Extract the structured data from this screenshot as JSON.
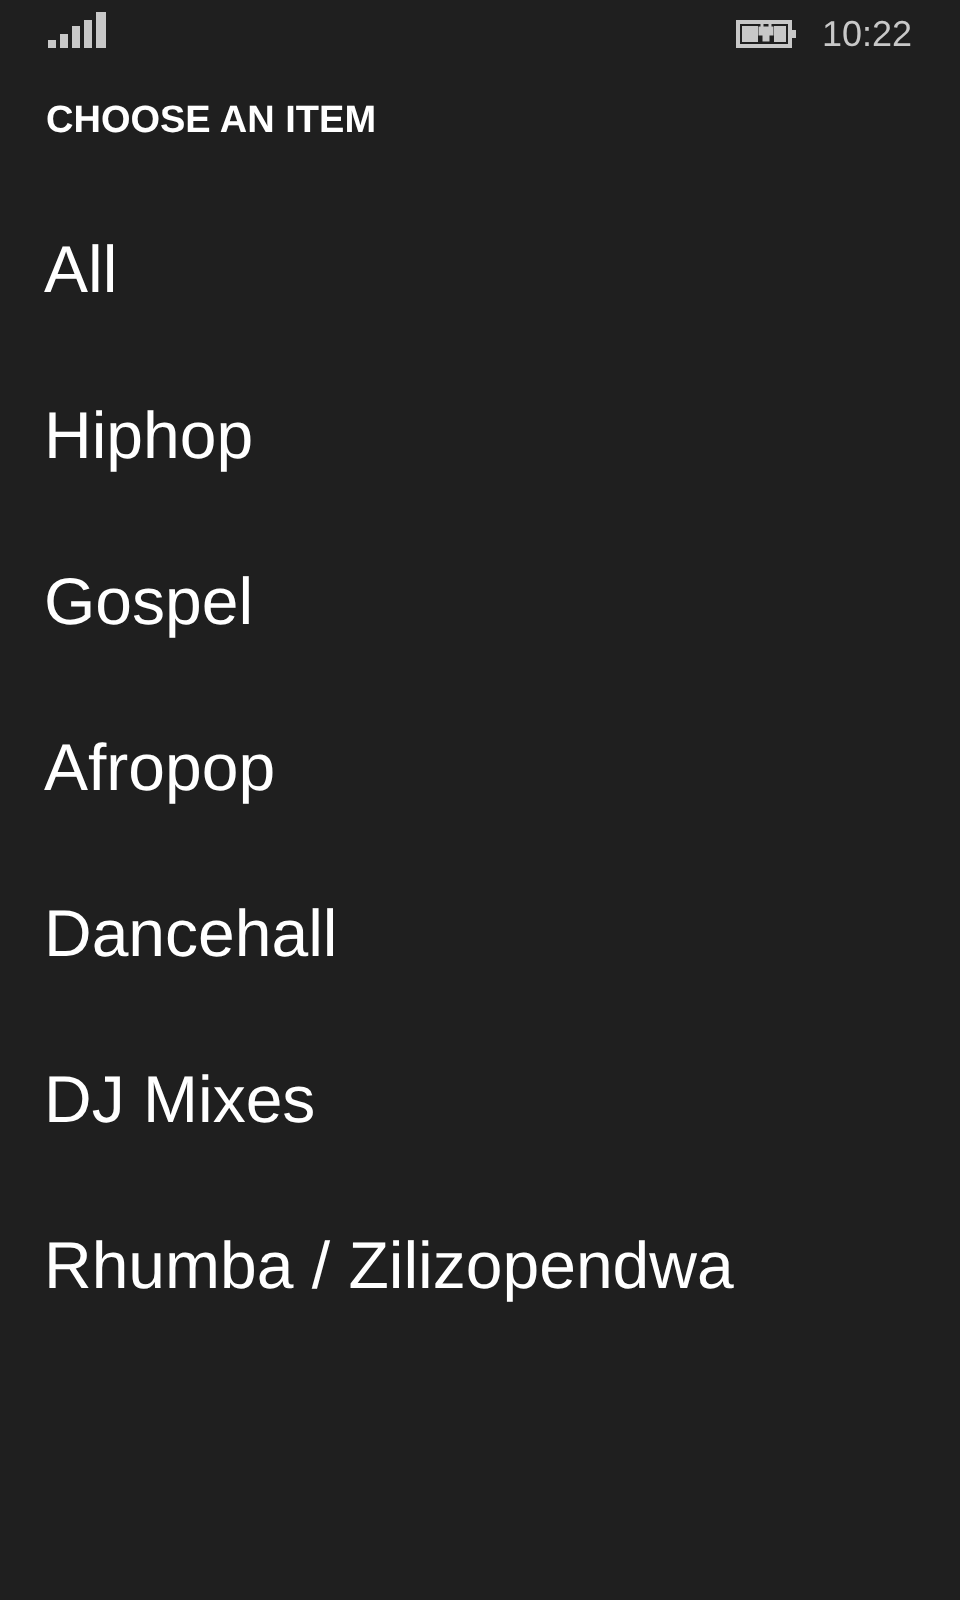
{
  "status_bar": {
    "time": "10:22"
  },
  "header": {
    "title": "CHOOSE AN ITEM"
  },
  "items": [
    {
      "label": "All"
    },
    {
      "label": "Hiphop"
    },
    {
      "label": "Gospel"
    },
    {
      "label": "Afropop"
    },
    {
      "label": "Dancehall"
    },
    {
      "label": "DJ Mixes"
    },
    {
      "label": "Rhumba / Zilizopendwa"
    }
  ]
}
